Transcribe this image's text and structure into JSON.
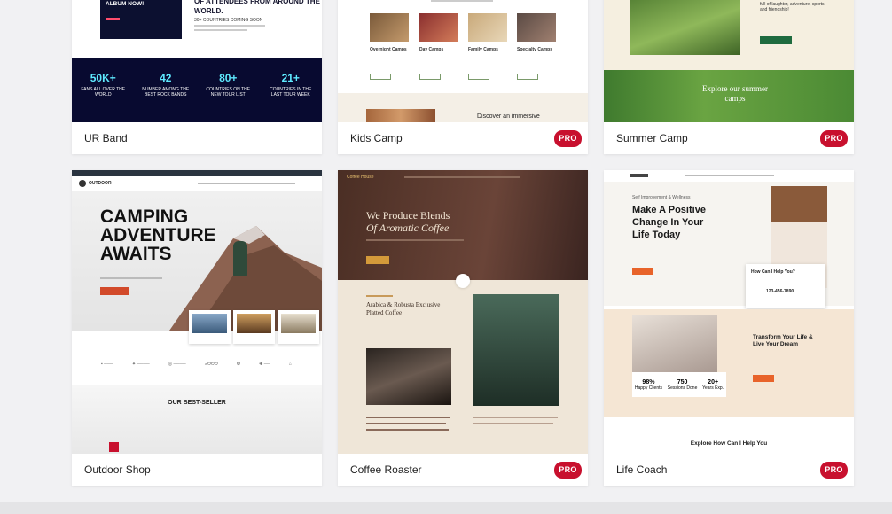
{
  "cards": [
    {
      "name": "UR Band",
      "pro": false,
      "preview": {
        "promo": "GET OUR NEW ALBUM NOW!",
        "headline": "OF ATTENDEES FROM AROUND THE WORLD.",
        "sub": "30+ COUNTRIES COMING SOON",
        "stats": [
          {
            "value": "50K+",
            "label": "FANS ALL OVER THE WORLD"
          },
          {
            "value": "42",
            "label": "NUMBER AMONG THE BEST ROCK BANDS"
          },
          {
            "value": "80+",
            "label": "COUNTRIES ON THE NEW TOUR LIST"
          },
          {
            "value": "21+",
            "label": "COUNTRIES IN THE LAST TOUR WEEK"
          }
        ]
      }
    },
    {
      "name": "Kids Camp",
      "pro": true,
      "preview": {
        "camps": [
          "Overnight Camps",
          "Day Camps",
          "Family Camps",
          "Specialty Camps"
        ],
        "discover": "Discover an immersive"
      }
    },
    {
      "name": "Summer Camp",
      "pro": true,
      "preview": {
        "blurb": "full of laughter, adventure, sports, and friendship!",
        "explore": "Explore our summer camps"
      }
    },
    {
      "name": "Outdoor Shop",
      "pro": false,
      "preview": {
        "logo": "OUTDOOR",
        "hero": [
          "CAMPING",
          "ADVENTURE",
          "AWAITS"
        ],
        "section": "OUR BEST-SELLER",
        "logos": [
          "▪ ───",
          "✦ ────",
          "◎ ────",
          "ΞΘΘΘ",
          "❂",
          "✚ ──",
          "⌂"
        ]
      }
    },
    {
      "name": "Coffee Roaster",
      "pro": true,
      "preview": {
        "brand": "Coffee House",
        "line1": "We Produce Blends",
        "line2": "Of Aromatic Coffee",
        "section": "Arabica & Robusta Exclusive Platted Coffee"
      }
    },
    {
      "name": "Life Coach",
      "pro": true,
      "preview": {
        "tag": "Self Improvement & Wellness",
        "hero": "Make A Positive Change In Your Life Today",
        "help": "How Can I Help You?",
        "phone": "123-456-7890",
        "transform": "Transform Your Life & Live Your Dream",
        "stats": [
          {
            "value": "98%",
            "label": "Happy Clients"
          },
          {
            "value": "750",
            "label": "Sessions Done"
          },
          {
            "value": "20+",
            "label": "Years Exp."
          }
        ],
        "explore": "Explore How Can I Help You"
      }
    }
  ],
  "pro_label": "PRO"
}
